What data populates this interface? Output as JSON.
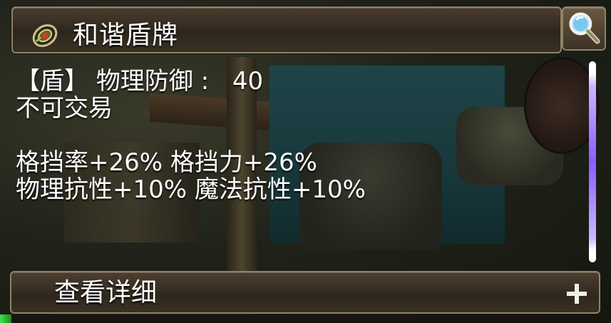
{
  "item": {
    "name": "和谐盾牌"
  },
  "stats": {
    "type_tag": "【盾】",
    "defense_label": "物理防御 :",
    "defense_value": "40",
    "trade_status": "不可交易",
    "line_block": "格挡率+26% 格挡力+26%",
    "line_resist": "物理抗性+10% 魔法抗性+10%"
  },
  "footer": {
    "detail_label": "查看详细"
  },
  "icons": {
    "item_icon": "shield-badge-icon",
    "search": "magnifier-icon",
    "expand": "plus-icon"
  },
  "colors": {
    "panel_text": "#ffffff",
    "panel_border": "#8e8366",
    "scrollbar_accent": "#8a5cff"
  },
  "scroll": {
    "position": 0
  }
}
